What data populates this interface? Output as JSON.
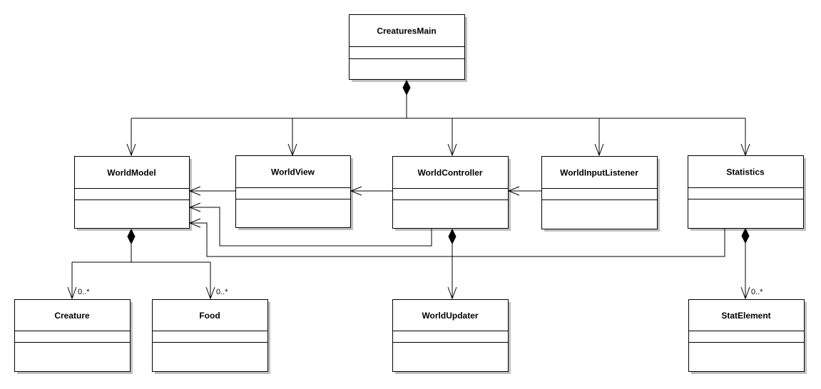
{
  "diagram": {
    "classes": {
      "creatures_main": "CreaturesMain",
      "world_model": "WorldModel",
      "world_view": "WorldView",
      "world_controller": "WorldController",
      "world_input_listener": "WorldInputListener",
      "statistics": "Statistics",
      "creature": "Creature",
      "food": "Food",
      "world_updater": "WorldUpdater",
      "stat_element": "StatElement"
    },
    "multiplicities": {
      "creature": "0..*",
      "food": "0..*",
      "stat_element": "0..*"
    },
    "relations": [
      {
        "from": "CreaturesMain",
        "to": "WorldModel",
        "type": "composition"
      },
      {
        "from": "CreaturesMain",
        "to": "WorldView",
        "type": "composition"
      },
      {
        "from": "CreaturesMain",
        "to": "WorldController",
        "type": "composition"
      },
      {
        "from": "CreaturesMain",
        "to": "WorldInputListener",
        "type": "composition"
      },
      {
        "from": "CreaturesMain",
        "to": "Statistics",
        "type": "composition"
      },
      {
        "from": "WorldView",
        "to": "WorldModel",
        "type": "association"
      },
      {
        "from": "WorldController",
        "to": "WorldView",
        "type": "association"
      },
      {
        "from": "WorldInputListener",
        "to": "WorldController",
        "type": "association"
      },
      {
        "from": "WorldController",
        "to": "WorldModel",
        "type": "association"
      },
      {
        "from": "Statistics",
        "to": "WorldModel",
        "type": "association"
      },
      {
        "from": "WorldModel",
        "to": "Creature",
        "type": "composition"
      },
      {
        "from": "WorldModel",
        "to": "Food",
        "type": "composition"
      },
      {
        "from": "WorldController",
        "to": "WorldUpdater",
        "type": "composition"
      },
      {
        "from": "Statistics",
        "to": "StatElement",
        "type": "composition"
      }
    ]
  }
}
